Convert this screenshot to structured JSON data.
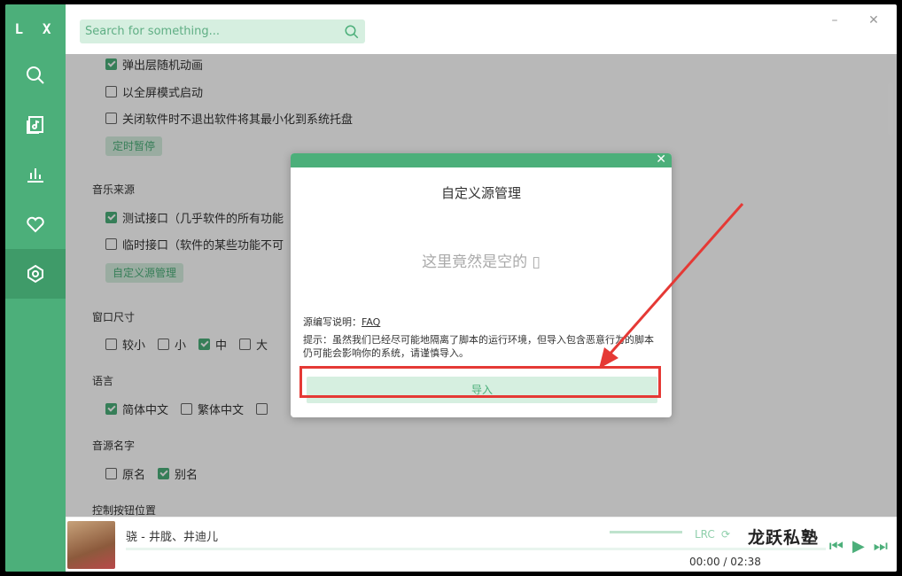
{
  "app": {
    "logo": "L X"
  },
  "search": {
    "placeholder": "Search for something..."
  },
  "sidebar": {
    "items": [
      {
        "icon": "search-icon"
      },
      {
        "icon": "music-list-icon"
      },
      {
        "icon": "chart-icon"
      },
      {
        "icon": "heart-icon"
      },
      {
        "icon": "settings-icon",
        "active": true
      }
    ]
  },
  "settings": {
    "opt_popup_anim": "弹出层随机动画",
    "opt_fullscreen": "以全屏模式启动",
    "opt_tray": "关闭软件时不退出软件将其最小化到系统托盘",
    "timer_btn": "定时暂停",
    "music_source_title": "音乐来源",
    "source_test": "测试接口（几乎软件的所有功能",
    "source_temp": "临时接口（软件的某些功能不可",
    "custom_source_btn": "自定义源管理",
    "window_size_title": "窗口尺寸",
    "size_options": [
      "较小",
      "小",
      "中",
      "大"
    ],
    "language_title": "语言",
    "language_options": [
      "简体中文",
      "繁体中文"
    ],
    "name_title": "音源名字",
    "name_options": [
      "原名",
      "别名"
    ],
    "control_title": "控制按钮位置"
  },
  "modal": {
    "title": "自定义源管理",
    "empty": "这里竟然是空的 ▯",
    "doc_label": "源编写说明：",
    "doc_link": "FAQ",
    "tip": "提示：虽然我们已经尽可能地隔离了脚本的运行环境，但导入包含恶意行为的脚本仍可能会影响你的系统，请谨慎导入。",
    "import_btn": "导入"
  },
  "player": {
    "song": "骁 - 井胧、井迪儿",
    "time_current": "00:00",
    "time_sep": "/",
    "time_total": "02:38",
    "lrc": "LRC",
    "watermark": "龙跃私塾"
  },
  "colors": {
    "accent": "#4caf7a",
    "accent_light": "#d6efe0",
    "highlight": "#e53935"
  }
}
